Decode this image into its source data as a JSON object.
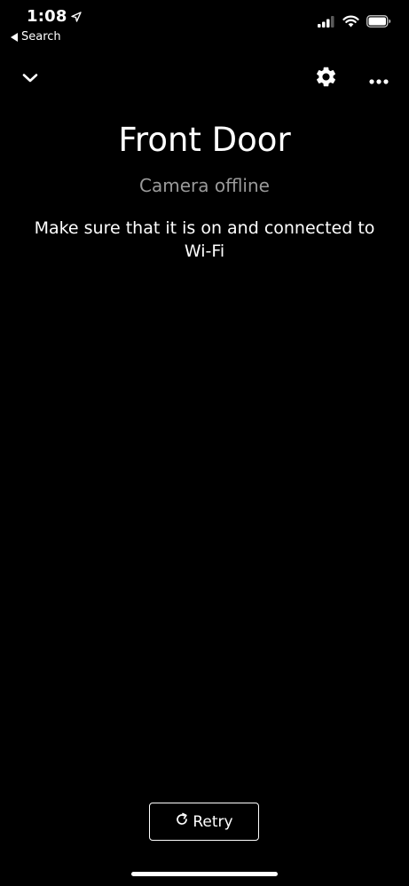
{
  "status_bar": {
    "time": "1:08",
    "back_app_label": "Search",
    "icons": [
      "location-arrow-icon",
      "cellular-signal-icon",
      "wifi-icon",
      "battery-icon"
    ]
  },
  "toolbar": {
    "icons": [
      "chevron-down-icon",
      "gear-icon",
      "more-horizontal-icon"
    ]
  },
  "camera": {
    "name": "Front Door",
    "status": "Camera offline",
    "message": "Make sure that it is on and connected to Wi-Fi"
  },
  "actions": {
    "retry_label": "Retry",
    "retry_icon": "refresh-icon"
  },
  "colors": {
    "background": "#000000",
    "text": "#ffffff",
    "muted_text": "#9a9a9a"
  }
}
